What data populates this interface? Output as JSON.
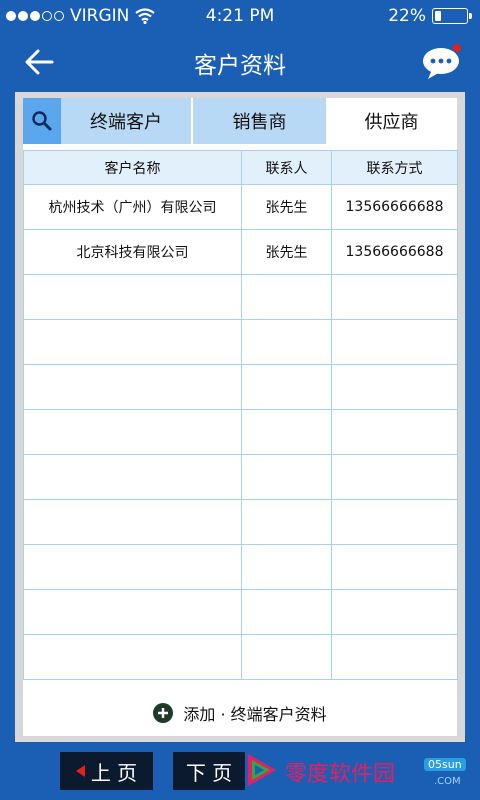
{
  "status": {
    "carrier": "VIRGIN",
    "time": "4:21 PM",
    "battery": "22%",
    "battery_level": 0.22
  },
  "nav": {
    "title": "客户资料"
  },
  "tabs": [
    {
      "label": "终端客户"
    },
    {
      "label": "销售商"
    },
    {
      "label": "供应商"
    }
  ],
  "table": {
    "headers": [
      "客户名称",
      "联系人",
      "联系方式"
    ],
    "rows": [
      [
        "杭州技术（广州）有限公司",
        "张先生",
        "13566666688"
      ],
      [
        "北京科技有限公司",
        "张先生",
        "13566666688"
      ],
      [
        "",
        "",
        ""
      ],
      [
        "",
        "",
        ""
      ],
      [
        "",
        "",
        ""
      ],
      [
        "",
        "",
        ""
      ],
      [
        "",
        "",
        ""
      ],
      [
        "",
        "",
        ""
      ],
      [
        "",
        "",
        ""
      ],
      [
        "",
        "",
        ""
      ],
      [
        "",
        "",
        ""
      ]
    ]
  },
  "add": {
    "label": "添加 · 终端客户资料"
  },
  "pager": {
    "prev": "上 页",
    "next": "下 页"
  },
  "watermark": {
    "text": "零度软件园",
    "badge": "05sun",
    "com": ".COM"
  },
  "colors": {
    "primary": "#1a5fb4",
    "tab_active": "#b8d9f5",
    "search_tab": "#5aa7ee",
    "table_header": "#e2f0fb",
    "pager_btn": "#0c1a30"
  }
}
